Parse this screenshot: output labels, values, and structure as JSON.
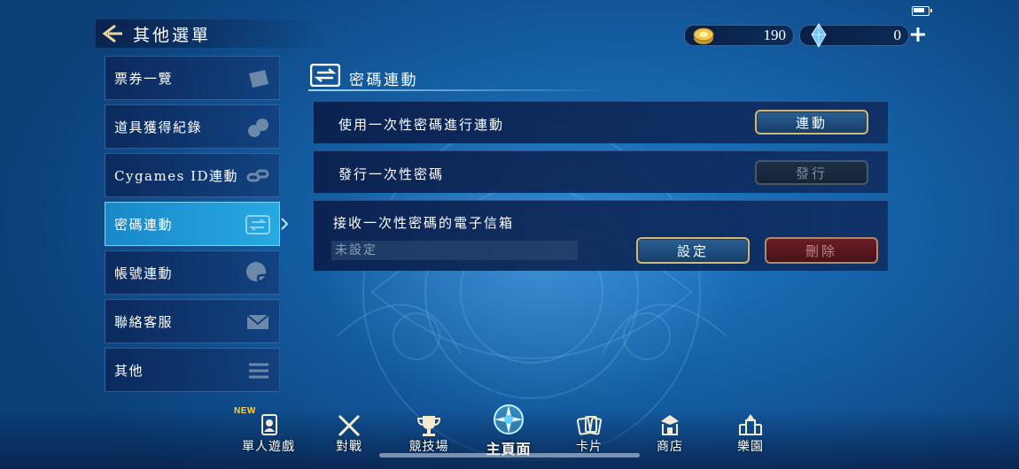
{
  "header": {
    "title": "其他選單"
  },
  "currency": {
    "gold": "190",
    "gems": "0"
  },
  "sidebar": {
    "items": [
      {
        "label": "票券一覽"
      },
      {
        "label": "道具獲得紀錄"
      },
      {
        "label": "Cygames ID連動"
      },
      {
        "label": "密碼連動"
      },
      {
        "label": "帳號連動"
      },
      {
        "label": "聯絡客服"
      },
      {
        "label": "其他"
      }
    ],
    "active_index": 3
  },
  "section": {
    "title": "密碼連動",
    "rows": {
      "link": {
        "label": "使用一次性密碼進行連動",
        "button": "連動"
      },
      "issue": {
        "label": "發行一次性密碼",
        "button": "發行"
      },
      "email": {
        "label": "接收一次性密碼的電子信箱",
        "placeholder": "未設定",
        "set_button": "設定",
        "delete_button": "刪除"
      }
    }
  },
  "bottom_nav": {
    "new_badge": "NEW",
    "items": [
      {
        "label": "單人遊戲",
        "icon": "single-player-card-icon"
      },
      {
        "label": "對戰",
        "icon": "crossed-swords-icon"
      },
      {
        "label": "競技場",
        "icon": "trophy-icon"
      },
      {
        "label": "主頁面",
        "icon": "home-crest-icon"
      },
      {
        "label": "卡片",
        "icon": "cards-icon"
      },
      {
        "label": "商店",
        "icon": "shop-icon"
      },
      {
        "label": "樂園",
        "icon": "castle-icon"
      }
    ]
  },
  "colors": {
    "accent": "#27a9e3",
    "button_border_gold": "#cfb978",
    "delete_red": "#6a1d25"
  }
}
